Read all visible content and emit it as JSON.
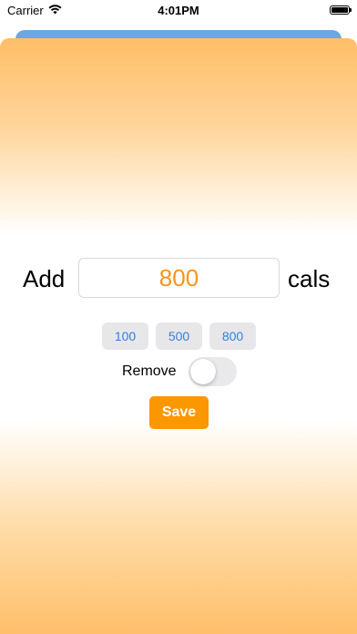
{
  "status_bar": {
    "carrier": "Carrier",
    "time": "4:01PM",
    "wifi_icon": "wifi-icon",
    "battery_icon": "battery-full-icon"
  },
  "colors": {
    "accent_orange": "#fb9700",
    "value_orange": "#f7941d",
    "link_blue": "#2f7fe0",
    "sheet_top": "#ffbe66",
    "background_sheet": "#6aa7e6"
  },
  "form": {
    "add_label": "Add",
    "amount_value": "800",
    "unit_label": "cals",
    "presets": [
      "100",
      "500",
      "800"
    ],
    "remove_label": "Remove",
    "remove_enabled": false,
    "save_label": "Save"
  }
}
